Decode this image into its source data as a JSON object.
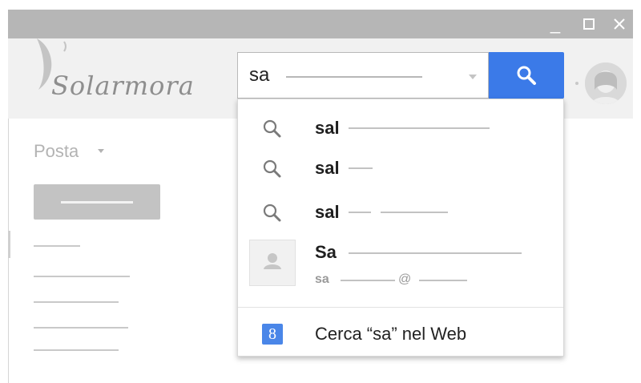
{
  "window": {
    "controls": {
      "minimize": "_",
      "maximize": "☐",
      "close": "✕"
    }
  },
  "header": {
    "logo_text": "Solarmora",
    "search": {
      "value": "sa",
      "button_icon": "search-icon"
    },
    "avatar_icon": "user-avatar-icon"
  },
  "sidebar": {
    "mail_label": "Posta"
  },
  "dropdown": {
    "suggestions": [
      {
        "icon": "search-icon",
        "text": "sal"
      },
      {
        "icon": "search-icon",
        "text": "sal"
      },
      {
        "icon": "search-icon",
        "text": "sal"
      }
    ],
    "contact": {
      "icon": "person-icon",
      "name": "Sa",
      "email_prefix": "sa",
      "email_at": "@"
    },
    "web_search": {
      "icon_label": "8",
      "text": "Cerca “sa” nel Web"
    }
  },
  "colors": {
    "accent": "#3b7ae8",
    "titlebar": "#b6b6b6",
    "header_bg": "#f1f1f1",
    "google_icon": "#4a86e8"
  }
}
